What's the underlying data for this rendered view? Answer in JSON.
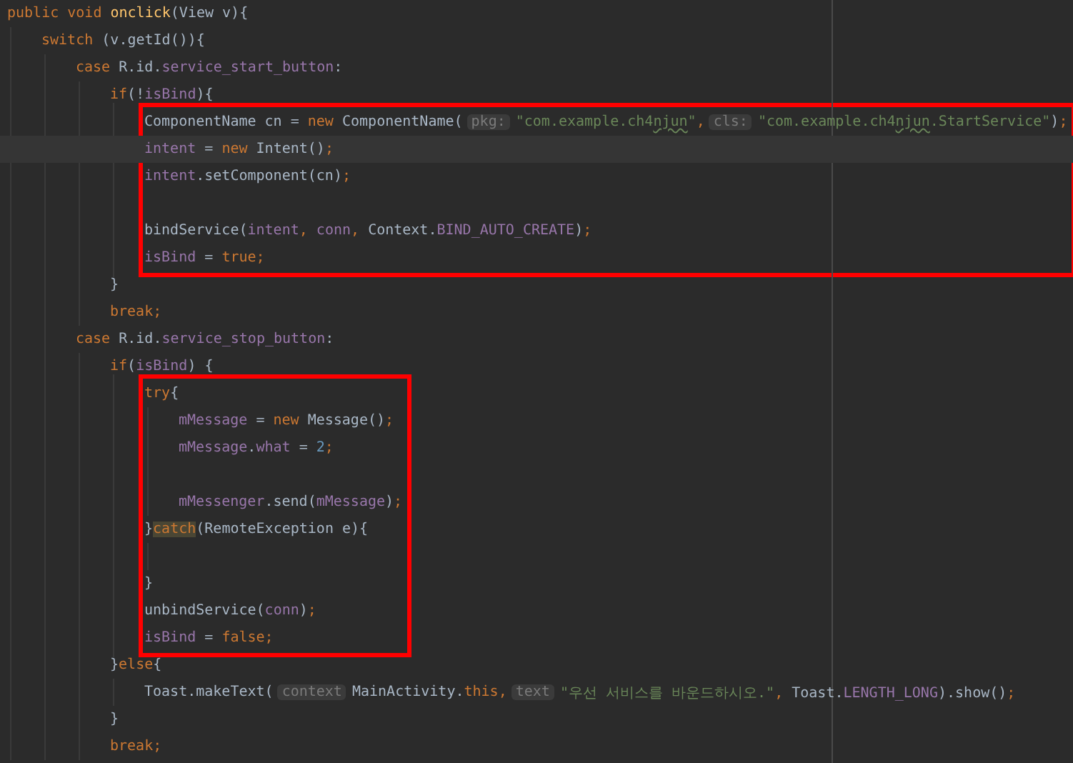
{
  "editor": {
    "lines": [
      {
        "kind": "code",
        "tokens": [
          {
            "kind": "kw",
            "text": "public void "
          },
          {
            "kind": "fn",
            "text": "onclick"
          },
          {
            "kind": "plain",
            "text": "(View v){"
          }
        ],
        "children": [
          {
            "kind": "code",
            "tokens": [
              {
                "kind": "kw",
                "text": "switch "
              },
              {
                "kind": "plain",
                "text": "(v.getId()){"
              }
            ],
            "children": [
              {
                "kind": "code",
                "tokens": [
                  {
                    "kind": "kw",
                    "text": "case "
                  },
                  {
                    "kind": "plain",
                    "text": "R.id."
                  },
                  {
                    "kind": "field",
                    "text": "service_start_button"
                  },
                  {
                    "kind": "plain",
                    "text": ":"
                  }
                ],
                "children": [
                  {
                    "kind": "code",
                    "outlined": true,
                    "tokens": [
                      {
                        "kind": "kw",
                        "text": "if"
                      },
                      {
                        "kind": "plain",
                        "text": "(!"
                      },
                      {
                        "kind": "field",
                        "text": "isBind"
                      },
                      {
                        "kind": "plain",
                        "text": "){"
                      }
                    ],
                    "children": [
                      {
                        "kind": "code",
                        "tokens": [
                          {
                            "kind": "plain",
                            "text": "ComponentName cn = "
                          },
                          {
                            "kind": "kw",
                            "text": "new "
                          },
                          {
                            "kind": "plain",
                            "text": "ComponentName("
                          },
                          {
                            "kind": "hint",
                            "text": "pkg:"
                          },
                          {
                            "kind": "str",
                            "text": "\"com.example.ch4"
                          },
                          {
                            "kind": "typo",
                            "text": "njun"
                          },
                          {
                            "kind": "str",
                            "text": "\""
                          },
                          {
                            "kind": "punct",
                            "text": ","
                          },
                          {
                            "kind": "hint",
                            "text": "cls:"
                          },
                          {
                            "kind": "str",
                            "text": "\"com.example.ch4"
                          },
                          {
                            "kind": "typo",
                            "text": "njun"
                          },
                          {
                            "kind": "str",
                            "text": ".StartService\""
                          },
                          {
                            "kind": "plain",
                            "text": ")"
                          },
                          {
                            "kind": "punct",
                            "text": ";"
                          }
                        ]
                      },
                      {
                        "kind": "code",
                        "current": true,
                        "tokens": [
                          {
                            "kind": "field",
                            "text": "intent"
                          },
                          {
                            "kind": "plain",
                            "text": " = "
                          },
                          {
                            "kind": "kw",
                            "text": "new "
                          },
                          {
                            "kind": "plain",
                            "text": "Intent()"
                          },
                          {
                            "kind": "punct",
                            "text": ";"
                          }
                        ]
                      },
                      {
                        "kind": "code",
                        "tokens": [
                          {
                            "kind": "field",
                            "text": "intent"
                          },
                          {
                            "kind": "plain",
                            "text": ".setComponent(cn)"
                          },
                          {
                            "kind": "punct",
                            "text": ";"
                          }
                        ]
                      },
                      {
                        "kind": "blank"
                      },
                      {
                        "kind": "code",
                        "tokens": [
                          {
                            "kind": "plain",
                            "text": "bindService("
                          },
                          {
                            "kind": "field",
                            "text": "intent"
                          },
                          {
                            "kind": "punct",
                            "text": ", "
                          },
                          {
                            "kind": "field",
                            "text": "conn"
                          },
                          {
                            "kind": "punct",
                            "text": ", "
                          },
                          {
                            "kind": "plain",
                            "text": "Context."
                          },
                          {
                            "kind": "field",
                            "text": "BIND_AUTO_CREATE"
                          },
                          {
                            "kind": "plain",
                            "text": ")"
                          },
                          {
                            "kind": "punct",
                            "text": ";"
                          }
                        ]
                      },
                      {
                        "kind": "code",
                        "tokens": [
                          {
                            "kind": "field",
                            "text": "isBind"
                          },
                          {
                            "kind": "plain",
                            "text": " = "
                          },
                          {
                            "kind": "kw",
                            "text": "true"
                          },
                          {
                            "kind": "punct",
                            "text": ";"
                          }
                        ]
                      }
                    ]
                  },
                  {
                    "kind": "code",
                    "tokens": [
                      {
                        "kind": "plain",
                        "text": "}"
                      }
                    ]
                  },
                  {
                    "kind": "code",
                    "tokens": [
                      {
                        "kind": "kw",
                        "text": "break"
                      },
                      {
                        "kind": "punct",
                        "text": ";"
                      }
                    ]
                  }
                ]
              },
              {
                "kind": "code",
                "tokens": [
                  {
                    "kind": "kw",
                    "text": "case "
                  },
                  {
                    "kind": "plain",
                    "text": "R.id."
                  },
                  {
                    "kind": "field",
                    "text": "service_stop_button"
                  },
                  {
                    "kind": "plain",
                    "text": ":"
                  }
                ],
                "children": [
                  {
                    "kind": "code",
                    "outlined": true,
                    "tokens": [
                      {
                        "kind": "kw",
                        "text": "if"
                      },
                      {
                        "kind": "plain",
                        "text": "("
                      },
                      {
                        "kind": "field",
                        "text": "isBind"
                      },
                      {
                        "kind": "plain",
                        "text": ") {"
                      }
                    ],
                    "children": [
                      {
                        "kind": "code",
                        "tokens": [
                          {
                            "kind": "kw",
                            "text": "try"
                          },
                          {
                            "kind": "plain",
                            "text": "{"
                          }
                        ],
                        "children": [
                          {
                            "kind": "code",
                            "tokens": [
                              {
                                "kind": "field",
                                "text": "mMessage"
                              },
                              {
                                "kind": "plain",
                                "text": " = "
                              },
                              {
                                "kind": "kw",
                                "text": "new "
                              },
                              {
                                "kind": "plain",
                                "text": "Message()"
                              },
                              {
                                "kind": "punct",
                                "text": ";"
                              }
                            ]
                          },
                          {
                            "kind": "code",
                            "tokens": [
                              {
                                "kind": "field",
                                "text": "mMessage"
                              },
                              {
                                "kind": "plain",
                                "text": "."
                              },
                              {
                                "kind": "field",
                                "text": "what"
                              },
                              {
                                "kind": "plain",
                                "text": " = "
                              },
                              {
                                "kind": "num",
                                "text": "2"
                              },
                              {
                                "kind": "punct",
                                "text": ";"
                              }
                            ]
                          },
                          {
                            "kind": "blank"
                          },
                          {
                            "kind": "code",
                            "tokens": [
                              {
                                "kind": "field",
                                "text": "mMessenger"
                              },
                              {
                                "kind": "plain",
                                "text": ".send("
                              },
                              {
                                "kind": "field",
                                "text": "mMessage"
                              },
                              {
                                "kind": "plain",
                                "text": ")"
                              },
                              {
                                "kind": "punct",
                                "text": ";"
                              }
                            ]
                          }
                        ]
                      },
                      {
                        "kind": "code",
                        "tokens": [
                          {
                            "kind": "plain",
                            "text": "}"
                          },
                          {
                            "kind": "match",
                            "text": "catch"
                          },
                          {
                            "kind": "plain",
                            "text": "(RemoteException e){"
                          }
                        ],
                        "children": [
                          {
                            "kind": "blank"
                          }
                        ]
                      },
                      {
                        "kind": "code",
                        "tokens": [
                          {
                            "kind": "plain",
                            "text": "}"
                          }
                        ]
                      },
                      {
                        "kind": "code",
                        "tokens": [
                          {
                            "kind": "plain",
                            "text": "unbindService("
                          },
                          {
                            "kind": "field",
                            "text": "conn"
                          },
                          {
                            "kind": "plain",
                            "text": ")"
                          },
                          {
                            "kind": "punct",
                            "text": ";"
                          }
                        ]
                      },
                      {
                        "kind": "code",
                        "tokens": [
                          {
                            "kind": "field",
                            "text": "isBind"
                          },
                          {
                            "kind": "plain",
                            "text": " = "
                          },
                          {
                            "kind": "kw",
                            "text": "false"
                          },
                          {
                            "kind": "punct",
                            "text": ";"
                          }
                        ]
                      }
                    ]
                  },
                  {
                    "kind": "code",
                    "tokens": [
                      {
                        "kind": "plain",
                        "text": "}"
                      },
                      {
                        "kind": "kw",
                        "text": "else"
                      },
                      {
                        "kind": "plain",
                        "text": "{"
                      }
                    ],
                    "children": [
                      {
                        "kind": "code",
                        "tokens": [
                          {
                            "kind": "plain",
                            "text": "Toast.makeText("
                          },
                          {
                            "kind": "hint",
                            "text": "context"
                          },
                          {
                            "kind": "plain",
                            "text": "MainActivity."
                          },
                          {
                            "kind": "kw",
                            "text": "this"
                          },
                          {
                            "kind": "punct",
                            "text": ","
                          },
                          {
                            "kind": "hint",
                            "text": "text"
                          },
                          {
                            "kind": "str",
                            "text": "\"우선 서비스를 바운드하시오.\""
                          },
                          {
                            "kind": "punct",
                            "text": ", "
                          },
                          {
                            "kind": "plain",
                            "text": "Toast."
                          },
                          {
                            "kind": "field",
                            "text": "LENGTH_LONG"
                          },
                          {
                            "kind": "plain",
                            "text": ").show()"
                          },
                          {
                            "kind": "punct",
                            "text": ";"
                          }
                        ]
                      }
                    ]
                  },
                  {
                    "kind": "code",
                    "tokens": [
                      {
                        "kind": "plain",
                        "text": "}"
                      }
                    ]
                  },
                  {
                    "kind": "code",
                    "tokens": [
                      {
                        "kind": "kw",
                        "text": "break"
                      },
                      {
                        "kind": "punct",
                        "text": ";"
                      }
                    ]
                  }
                ]
              }
            ]
          }
        ]
      }
    ]
  }
}
